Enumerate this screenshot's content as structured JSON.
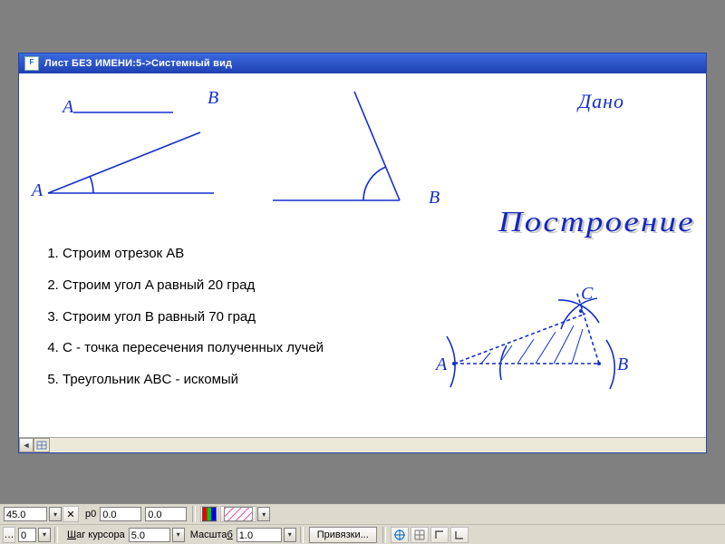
{
  "window": {
    "title": "Лист БЕЗ ИМЕНИ:5->Системный вид"
  },
  "labels": {
    "A_top": "A",
    "B_top": "B",
    "A_low": "A",
    "B_low": "B",
    "dano": "Дано",
    "postroenie": "Построение",
    "tri_A": "A",
    "tri_B": "B",
    "tri_C": "C"
  },
  "steps": [
    "Строим отрезок AB",
    "Строим угол A равный 20 град",
    "Строим угол B равный 70 град",
    "C - точка пересечения полученных лучей",
    "Треугольник ABC - искомый"
  ],
  "toolbar1": {
    "field1": "45.0",
    "p0_label": "p0",
    "p0_x": "0.0",
    "p0_y": "0.0"
  },
  "toolbar2": {
    "first": "0",
    "step_label": "Шаг курсора",
    "step_value": "5.0",
    "scale_label": "Масштаб",
    "scale_value": "1.0",
    "snap_btn": "Привязки..."
  }
}
